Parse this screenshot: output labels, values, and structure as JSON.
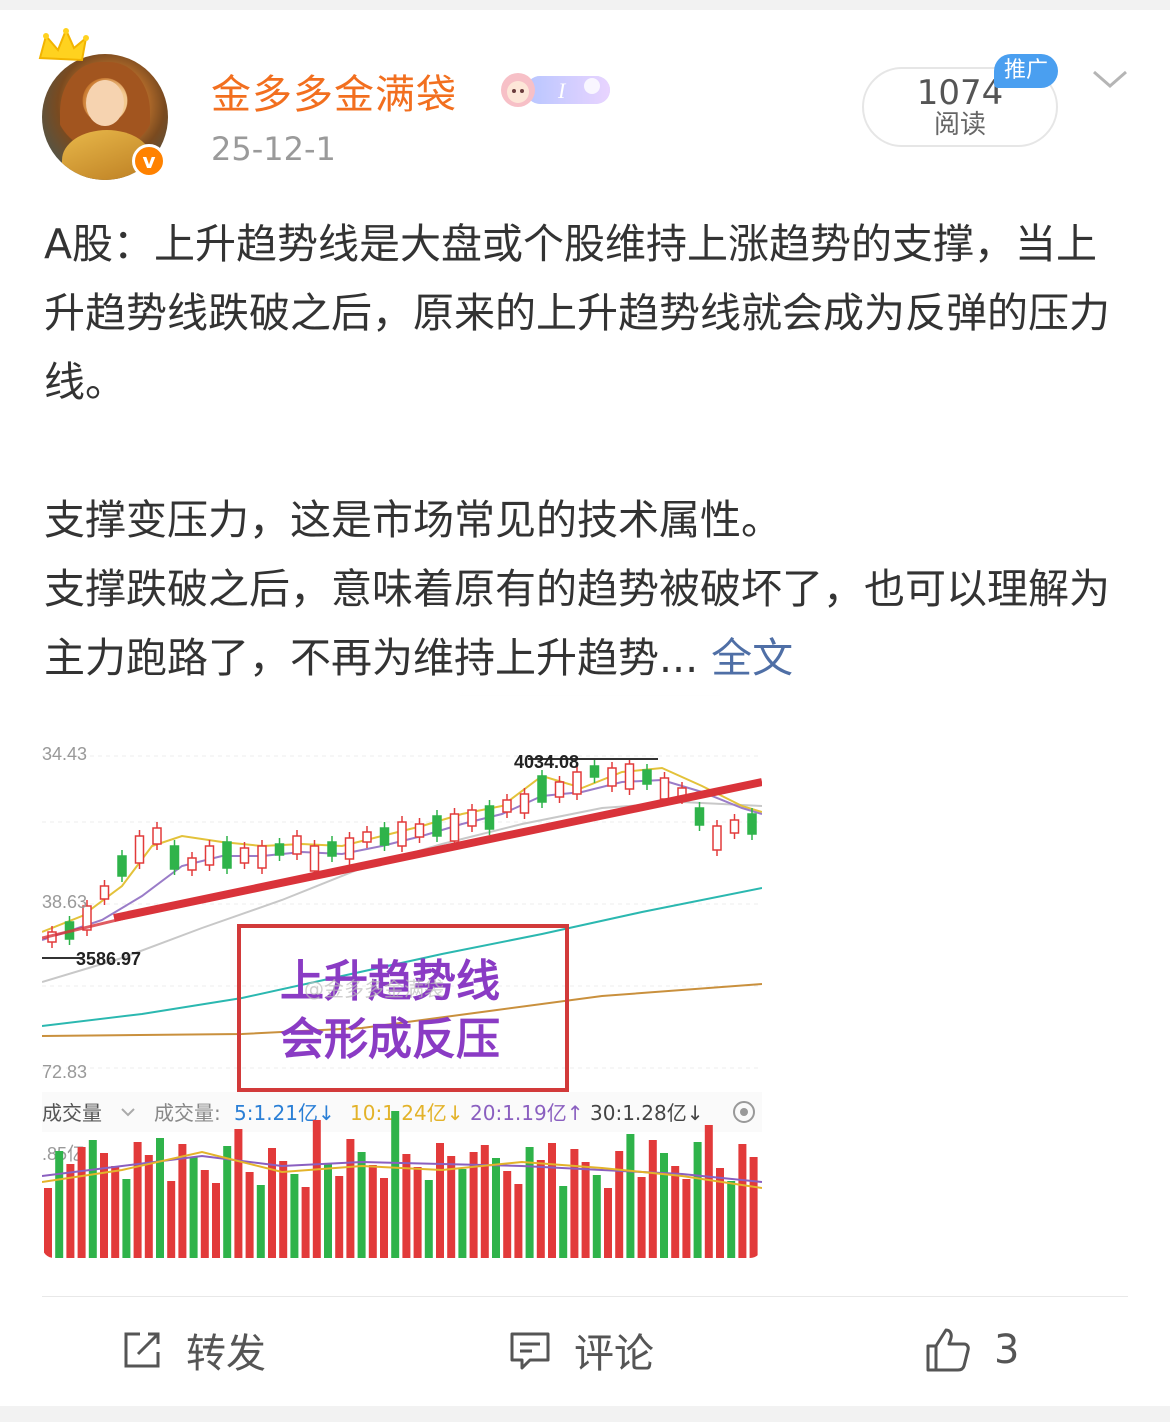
{
  "post": {
    "username": "金多多金满袋",
    "date": "25-12-1",
    "reads_count": "1074",
    "reads_label": "阅读",
    "promo_badge": "推广",
    "paragraph1": "A股：上升趋势线是大盘或个股维持上涨趋势的支撑，当上升趋势线跌破之后，原来的上升趋势线就会成为反弹的压力线。",
    "paragraph2": "支撑变压力，这是市场常见的技术属性。",
    "paragraph3": "支撑跌破之后，意味着原有的趋势被破坏了，也可以理解为主力跑路了，不再为维持上升趋势...",
    "full_text_link": "全文"
  },
  "image": {
    "price_labels": [
      "34.43",
      "4034.08",
      "38.63",
      "3586.97",
      "72.83"
    ],
    "annotation_line1": "上升趋势线",
    "annotation_line2": "会形成反压",
    "watermark": "@金多多金满袋",
    "volume_dropdown": "成交量",
    "volume_title": "成交量:",
    "vol5": "5:1.21亿↓",
    "vol10": "10:1.24亿↓",
    "vol20": "20:1.19亿↑",
    "vol30": "30:1.28亿↓",
    "vol_axis": ".85亿",
    "colors": {
      "up": "#e23a3a",
      "down": "#2fb34a",
      "trend": "#d9333a",
      "ma_cyan": "#2bb8b0",
      "ma_brown": "#c9903d"
    }
  },
  "actions": {
    "repost": "转发",
    "comment": "评论",
    "like_count": "3"
  }
}
